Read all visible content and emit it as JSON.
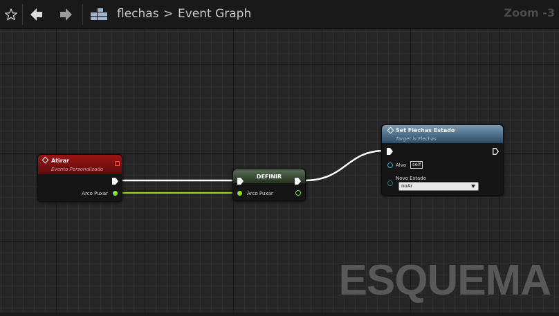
{
  "toolbar": {
    "icons": [
      "star-icon",
      "back-arrow-icon",
      "forward-arrow-icon",
      "blueprint-icon"
    ],
    "breadcrumb": {
      "root": "flechas",
      "separator": ">",
      "current": "Event Graph"
    },
    "zoom_label": "Zoom -3"
  },
  "watermark": "ESQUEMA",
  "nodes": {
    "atirar": {
      "title": "Atirar",
      "subtitle": "Evento Personalizado",
      "pin_label": "Arco Puxar"
    },
    "definir": {
      "title": "DEFINIR",
      "pin_label": "Arco Puxar"
    },
    "set_state": {
      "title": "Set Flechas Estado",
      "subtitle": "Target is Flechas",
      "target_label": "Alvo",
      "target_value": "self",
      "state_label": "Novo Estado",
      "state_value": "noAr"
    }
  },
  "colors": {
    "event_header": "#7a1010",
    "set_header": "#3c5d76",
    "definir_header": "#3a5036",
    "bool_pin": "#8ee02a",
    "object_pin": "#3fa9d8",
    "enum_pin": "#1f7a6e",
    "exec_wire": "#ffffff"
  }
}
